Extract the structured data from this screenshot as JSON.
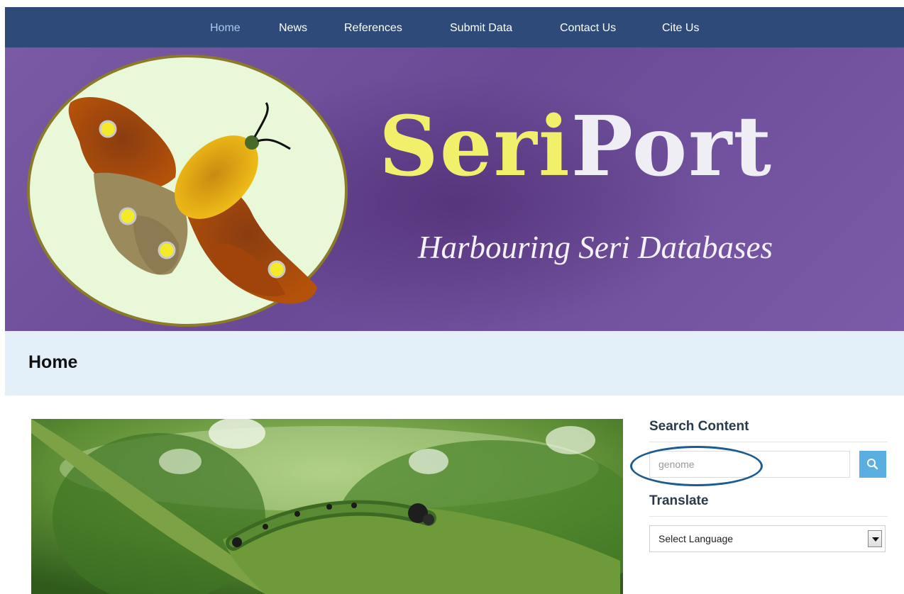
{
  "nav": {
    "items": [
      {
        "label": "Home",
        "active": true
      },
      {
        "label": "News",
        "active": false
      },
      {
        "label": "References",
        "active": false
      },
      {
        "label": "Submit Data",
        "active": false
      },
      {
        "label": "Contact Us",
        "active": false
      },
      {
        "label": "Cite Us",
        "active": false
      }
    ]
  },
  "banner": {
    "brand_part1": "Seri",
    "brand_part2": "Port",
    "tagline": "Harbouring Seri Databases"
  },
  "page": {
    "title": "Home"
  },
  "sidebar": {
    "search": {
      "title": "Search Content",
      "value": "genome",
      "button_icon": "search-icon"
    },
    "translate": {
      "title": "Translate",
      "selected": "Select Language"
    }
  },
  "colors": {
    "nav_bg": "#2d4a78",
    "nav_active": "#a9c9ee",
    "banner_purple": "#6a4a95",
    "brand_yellow": "#f2f06a",
    "title_bar_bg": "#e4f0f9",
    "search_button": "#5aaee0",
    "annotation_circle": "#1e5c8f"
  }
}
